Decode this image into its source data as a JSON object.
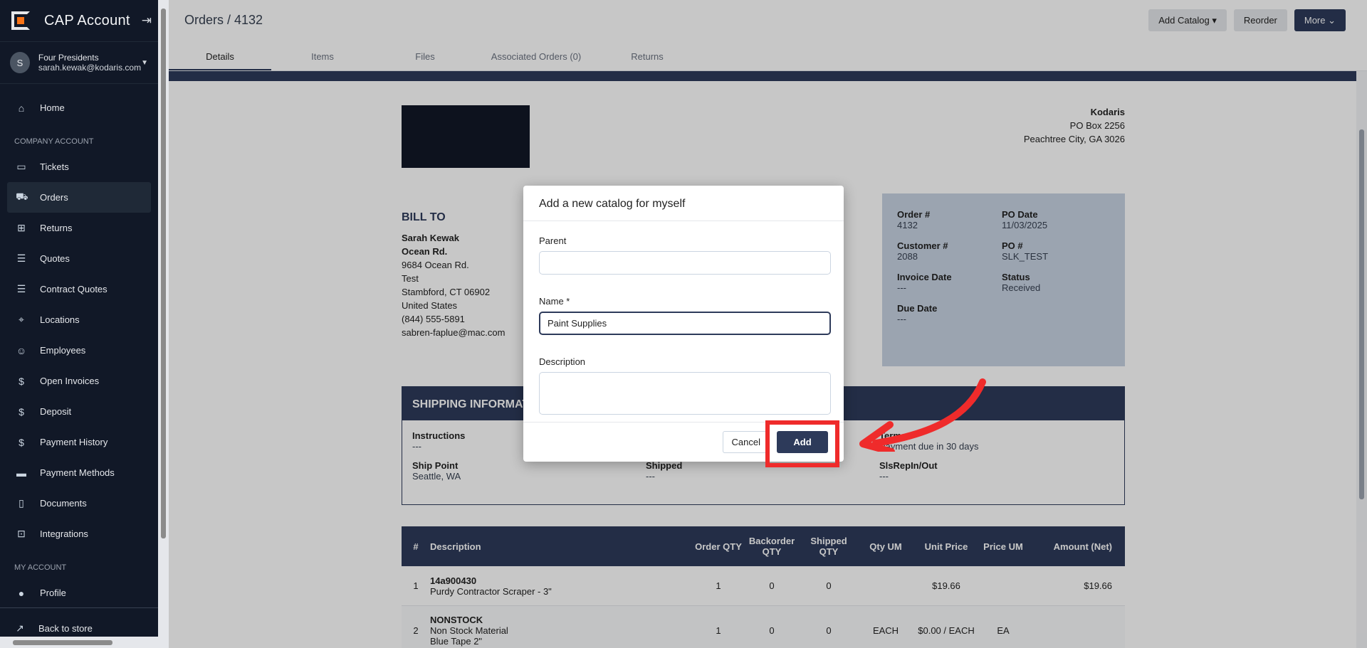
{
  "sidebar": {
    "brand": "CAP Account",
    "user_name": "Four Presidents",
    "user_email": "sarah.kewak@kodaris.com",
    "avatar_letter": "S",
    "home": "Home",
    "company_section": "COMPANY ACCOUNT",
    "items": [
      "Tickets",
      "Orders",
      "Returns",
      "Quotes",
      "Contract Quotes",
      "Locations",
      "Employees",
      "Open Invoices",
      "Deposit",
      "Payment History",
      "Payment Methods",
      "Documents",
      "Integrations"
    ],
    "my_section": "MY ACCOUNT",
    "profile": "Profile",
    "back": "Back to store"
  },
  "header": {
    "title": "Orders / 4132",
    "add_catalog": "Add Catalog ▾",
    "reorder": "Reorder",
    "more": "More ⌄"
  },
  "tabs": [
    "Details",
    "Items",
    "Files",
    "Associated Orders (0)",
    "Returns"
  ],
  "company": {
    "name": "Kodaris",
    "line1": "PO Box 2256",
    "line2": "Peachtree City, GA 3026"
  },
  "bill_to": {
    "heading": "BILL TO",
    "name": "Sarah Kewak",
    "street_bold": "Ocean Rd.",
    "lines": [
      "9684 Ocean Rd.",
      "Test",
      "Stambford, CT 06902",
      "United States",
      "(844) 555-5891",
      "sabren-faplue@mac.com"
    ]
  },
  "order_info": [
    {
      "k": "Order #",
      "v": "4132"
    },
    {
      "k": "PO Date",
      "v": "11/03/2025"
    },
    {
      "k": "Customer #",
      "v": "2088"
    },
    {
      "k": "PO #",
      "v": "SLK_TEST"
    },
    {
      "k": "Invoice Date",
      "v": "---"
    },
    {
      "k": "Status",
      "v": "Received"
    },
    {
      "k": "Due Date",
      "v": "---"
    }
  ],
  "shipping": {
    "heading": "SHIPPING INFORMATION",
    "fields": [
      {
        "k": "Instructions",
        "v": "---"
      },
      {
        "k": "",
        "v": ""
      },
      {
        "k": "Terms",
        "v": "Payment due in 30 days"
      },
      {
        "k": "Ship Point",
        "v": "Seattle, WA"
      },
      {
        "k": "Shipped",
        "v": "---"
      },
      {
        "k": "SlsRepIn/Out",
        "v": "---"
      }
    ]
  },
  "table": {
    "headers": [
      "#",
      "Description",
      "Order QTY",
      "Backorder QTY",
      "Shipped QTY",
      "Qty UM",
      "Unit Price",
      "Price UM",
      "Amount (Net)"
    ],
    "rows": [
      {
        "n": "1",
        "sku": "14a900430",
        "desc": "Purdy Contractor Scraper - 3\"",
        "desc2": "",
        "oq": "1",
        "bq": "0",
        "sq": "0",
        "um": "",
        "price": "$19.66",
        "pum": "",
        "amt": "$19.66"
      },
      {
        "n": "2",
        "sku": "NONSTOCK",
        "desc": "Non Stock Material",
        "desc2": "Blue Tape 2\"",
        "oq": "1",
        "bq": "0",
        "sq": "0",
        "um": "EACH",
        "price": "$0.00 / EACH",
        "pum": "EA",
        "amt": ""
      }
    ]
  },
  "modal": {
    "title": "Add a new catalog for myself",
    "parent_label": "Parent",
    "parent_value": "",
    "name_label": "Name *",
    "name_value": "Paint Supplies",
    "description_label": "Description",
    "cancel": "Cancel",
    "add": "Add"
  },
  "colors": {
    "navy": "#2d3a5a",
    "sidebar": "#111827",
    "highlight": "#ef2b2b"
  }
}
